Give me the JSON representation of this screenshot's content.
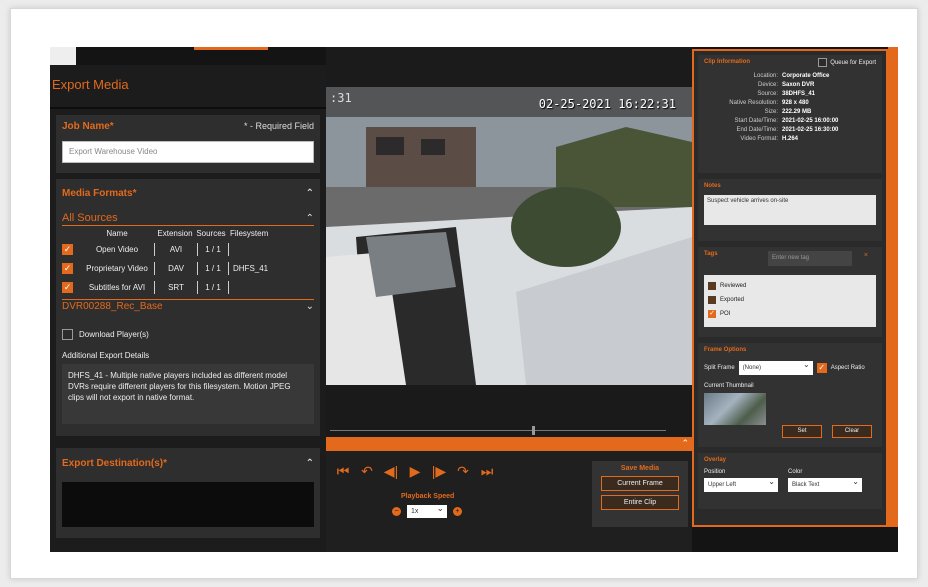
{
  "left": {
    "title": "Export Media",
    "job": {
      "label": "Job Name*",
      "required_note": "* - Required Field",
      "value": "Export Warehouse Video"
    },
    "media": {
      "label": "Media Formats*",
      "sources_label": "All Sources",
      "headers": [
        "Name",
        "Extension",
        "Sources",
        "Filesystem"
      ],
      "rows": [
        {
          "name": "Open Video",
          "ext": "AVI",
          "sources": "1 / 1",
          "fs": ""
        },
        {
          "name": "Proprietary Video",
          "ext": "DAV",
          "sources": "1 / 1",
          "fs": "DHFS_41"
        },
        {
          "name": "Subtitles for AVI",
          "ext": "SRT",
          "sources": "1 / 1",
          "fs": ""
        }
      ],
      "dvr_label": "DVR00288_Rec_Base"
    },
    "download_player": "Download Player(s)",
    "additional_label": "Additional Export Details",
    "additional_text": "DHFS_41 - Multiple native players included as different model DVRs require different players for this filesystem. Motion JPEG clips will not export in native format.",
    "destination_label": "Export Destination(s)*"
  },
  "video": {
    "timestamp": "02-25-2021 16:22:31",
    "corner": ":31"
  },
  "controls": {
    "icons": [
      "skip-start-icon",
      "reply-icon",
      "step-back-icon",
      "play-icon",
      "step-forward-icon",
      "forward-icon",
      "skip-end-icon"
    ],
    "glyphs": [
      "⏮",
      "↶",
      "◀|",
      "▶",
      "|▶",
      "↷",
      "⏭"
    ],
    "speed_label": "Playback Speed",
    "speed_value": "1x",
    "save_title": "Save Media",
    "current_frame": "Current Frame",
    "entire_clip": "Entire Clip"
  },
  "clip": {
    "title": "Clip Information",
    "queue_label": "Queue for Export",
    "info": [
      {
        "k": "Location:",
        "v": "Corporate Office"
      },
      {
        "k": "Device:",
        "v": "Saxon DVR"
      },
      {
        "k": "Source:",
        "v": "38DHFS_41"
      },
      {
        "k": "Native Resolution:",
        "v": "928 x 480"
      },
      {
        "k": "Size:",
        "v": "222.29 MB"
      },
      {
        "k": "Start Date/Time:",
        "v": "2021-02-25 16:00:00"
      },
      {
        "k": "End Date/Time:",
        "v": "2021-02-25 16:30:00"
      },
      {
        "k": "Video Format:",
        "v": "H.264"
      }
    ]
  },
  "notes": {
    "title": "Notes",
    "text": "Suspect vehicle arrives on-site"
  },
  "tags": {
    "title": "Tags",
    "placeholder": "Enter new tag",
    "items": [
      {
        "label": "Reviewed",
        "checked": false
      },
      {
        "label": "Exported",
        "checked": false
      },
      {
        "label": "POI",
        "checked": true
      }
    ]
  },
  "frame": {
    "title": "Frame Options",
    "split_label": "Split Frame",
    "split_value": "(None)",
    "aspect_label": "Aspect Ratio",
    "thumb_label": "Current Thumbnail",
    "set_label": "Set",
    "clear_label": "Clear"
  },
  "overlay": {
    "title": "Overlay",
    "position_label": "Position",
    "position_value": "Upper Left",
    "color_label": "Color",
    "color_value": "Black Text"
  },
  "colors": {
    "accent": "#e36a1c",
    "panel": "#2e2e2e",
    "background": "#141414"
  }
}
